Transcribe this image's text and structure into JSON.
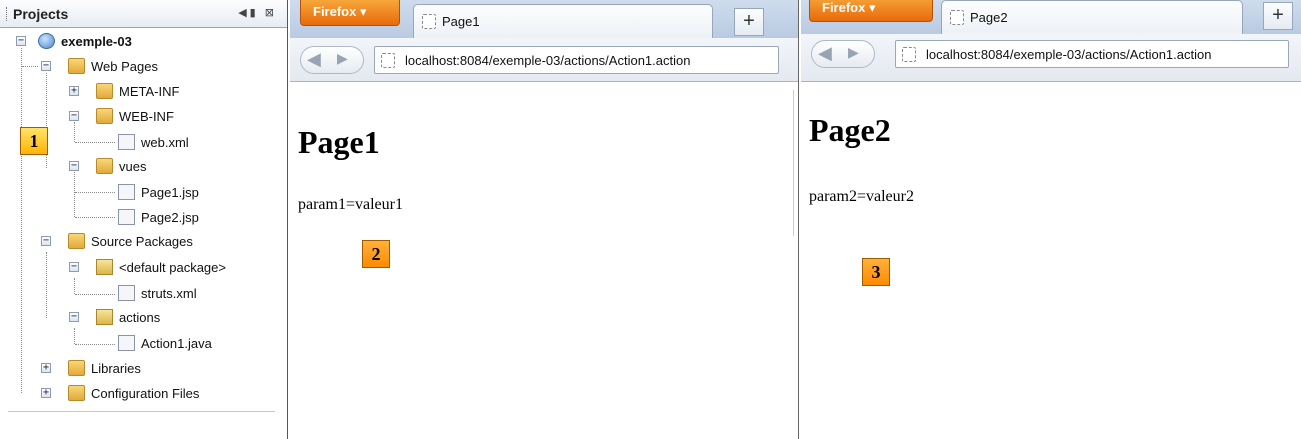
{
  "projects": {
    "title": "Projects",
    "tools": "◀▮ ⊠",
    "tree": [
      {
        "label": "exemple-03",
        "bold": true
      },
      {
        "label": "Web Pages"
      },
      {
        "label": "META-INF"
      },
      {
        "label": "WEB-INF"
      },
      {
        "label": "web.xml"
      },
      {
        "label": "vues"
      },
      {
        "label": "Page1.jsp"
      },
      {
        "label": "Page2.jsp"
      },
      {
        "label": "Source Packages"
      },
      {
        "label": "<default package>"
      },
      {
        "label": "struts.xml"
      },
      {
        "label": "actions"
      },
      {
        "label": "Action1.java"
      },
      {
        "label": "Libraries"
      },
      {
        "label": "Configuration Files"
      }
    ]
  },
  "markers": [
    "1",
    "2",
    "3"
  ],
  "browsers": [
    {
      "app_button": "Firefox ▾",
      "tab_title": "Page1",
      "new_tab": "+",
      "url": "localhost:8084/exemple-03/actions/Action1.action",
      "heading": "Page1",
      "text": "param1=valeur1"
    },
    {
      "app_button": "Firefox ▾",
      "tab_title": "Page2",
      "new_tab": "+",
      "url": "localhost:8084/exemple-03/actions/Action1.action",
      "heading": "Page2",
      "text": "param2=valeur2"
    }
  ]
}
